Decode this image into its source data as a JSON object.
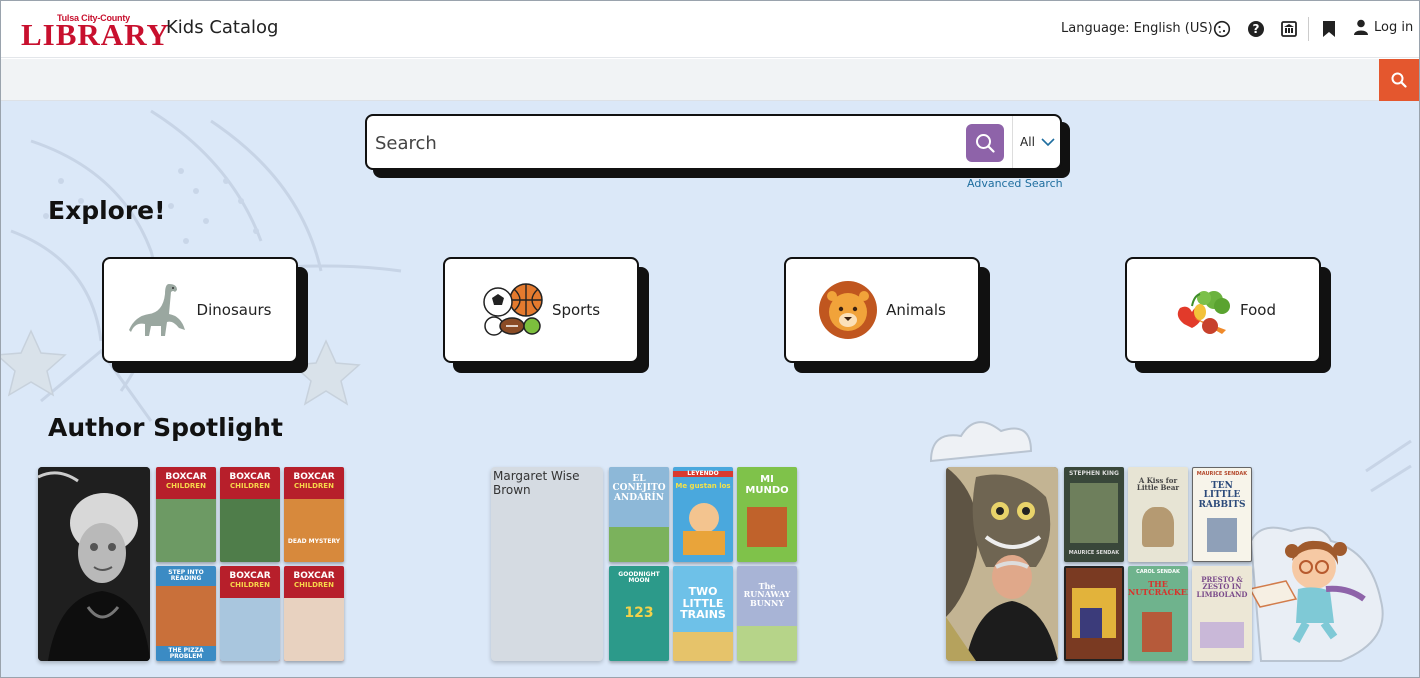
{
  "header": {
    "logo_small": "Tulsa City-County",
    "logo_big": "LIBRARY",
    "app_title": "Kids Catalog",
    "language_label": "Language: English (US)",
    "login_label": "Log in",
    "icons": [
      "cookie-icon",
      "help-icon",
      "library-building-icon",
      "bookmark-icon",
      "user-icon"
    ]
  },
  "search": {
    "placeholder": "Search",
    "scope_value": "All",
    "advanced_label": "Advanced Search"
  },
  "explore": {
    "heading": "Explore!",
    "categories": [
      {
        "label": "Dinosaurs",
        "icon": "dinosaur-icon"
      },
      {
        "label": "Sports",
        "icon": "sports-balls-icon"
      },
      {
        "label": "Animals",
        "icon": "lion-icon"
      },
      {
        "label": "Food",
        "icon": "vegetables-icon"
      }
    ]
  },
  "spotlight": {
    "heading": "Author Spotlight",
    "authors": [
      {
        "books": [
          {
            "top": "BOXCAR",
            "mid": "CHILDREN",
            "bottom": ""
          },
          {
            "top": "BOXCAR",
            "mid": "CHILDREN",
            "bottom": ""
          },
          {
            "top": "BOXCAR",
            "mid": "CHILDREN",
            "bottom": "DEAD MYSTERY"
          },
          {
            "top": "STEP INTO READING",
            "mid": "",
            "bottom": "THE PIZZA PROBLEM"
          },
          {
            "top": "BOXCAR",
            "mid": "CHILDREN",
            "bottom": ""
          },
          {
            "top": "BOXCAR",
            "mid": "CHILDREN",
            "bottom": ""
          }
        ]
      },
      {
        "portrait_alt": "Margaret Wise Brown",
        "books": [
          {
            "top": "EL CONEJITO ANDARÍN",
            "mid": "",
            "bottom": ""
          },
          {
            "top": "LEYENDO",
            "mid": "Me gustan los",
            "bottom": ""
          },
          {
            "top": "MI MUNDO",
            "mid": "",
            "bottom": ""
          },
          {
            "top": "GOODNIGHT MOON",
            "mid": "123",
            "bottom": ""
          },
          {
            "top": "TWO LITTLE TRAINS",
            "mid": "",
            "bottom": ""
          },
          {
            "top": "The RUNAWAY BUNNY",
            "mid": "",
            "bottom": ""
          }
        ]
      },
      {
        "books": [
          {
            "top": "STEPHEN KING",
            "mid": "",
            "bottom": "MAURICE SENDAK"
          },
          {
            "top": "A Kiss for Little Bear",
            "mid": "",
            "bottom": ""
          },
          {
            "top": "MAURICE SENDAK",
            "mid": "TEN LITTLE RABBITS",
            "bottom": ""
          },
          {
            "top": "",
            "mid": "",
            "bottom": ""
          },
          {
            "top": "CAROL SENDAK",
            "mid": "THE NUTCRACKER",
            "bottom": ""
          },
          {
            "top": "PRESTO & ZESTO IN LIMBOLAND",
            "mid": "",
            "bottom": ""
          }
        ]
      }
    ]
  }
}
